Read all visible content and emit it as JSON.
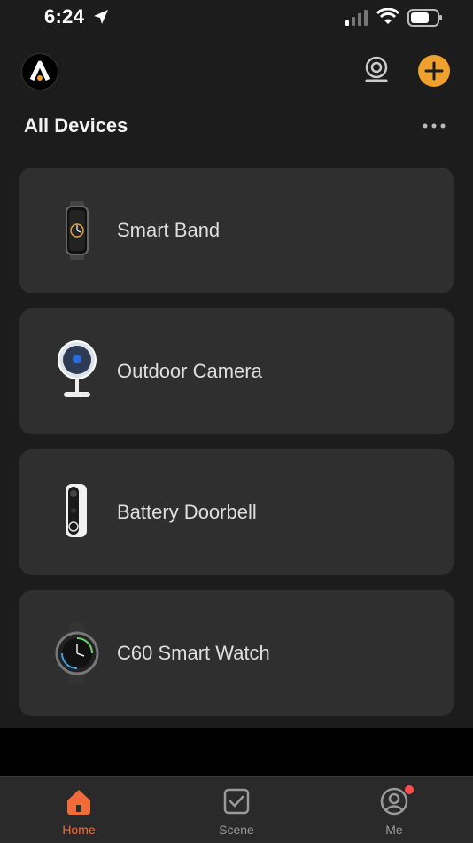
{
  "status_bar": {
    "time": "6:24",
    "icons": [
      "location-arrow-icon",
      "signal-bars-icon",
      "wifi-icon",
      "battery-icon"
    ]
  },
  "header": {
    "logo_icon": "app-logo-icon",
    "camera_icon": "camera-icon",
    "add_icon": "plus-icon",
    "title": "All Devices",
    "more_icon": "more-dots-icon"
  },
  "devices": [
    {
      "name": "Smart Band",
      "icon": "smart-band-icon"
    },
    {
      "name": "Outdoor Camera",
      "icon": "outdoor-camera-icon"
    },
    {
      "name": "Battery Doorbell",
      "icon": "doorbell-icon"
    },
    {
      "name": "C60 Smart Watch",
      "icon": "smart-watch-icon"
    }
  ],
  "tabs": [
    {
      "label": "Home",
      "icon": "home-icon",
      "active": true
    },
    {
      "label": "Scene",
      "icon": "scene-icon",
      "active": false
    },
    {
      "label": "Me",
      "icon": "profile-icon",
      "active": false,
      "badge": true
    }
  ],
  "colors": {
    "background": "#1c1c1c",
    "card": "#2f2f2f",
    "accent": "#f0a02c",
    "tab_active": "#f06b3a",
    "badge": "#ff4d4d"
  }
}
